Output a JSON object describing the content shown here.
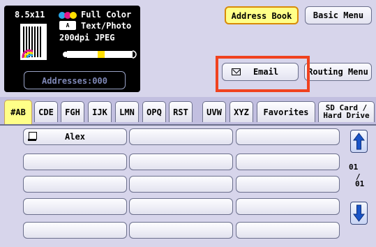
{
  "status": {
    "paper_size": "8.5x11",
    "color_mode": "Full Color",
    "image_mode": "Text/Photo",
    "mode_icon_text": "A ",
    "resolution": "200dpi JPEG",
    "addresses_button": "Addresses:000",
    "color_dots": [
      "#2aa7e8",
      "#e3198a",
      "#ffdf00"
    ]
  },
  "header": {
    "address_book": "Address Book",
    "basic_menu": "Basic Menu",
    "email": "Email",
    "routing_menu": "Routing Menu"
  },
  "tabs": [
    {
      "label": "#AB",
      "active": true
    },
    {
      "label": "CDE"
    },
    {
      "label": "FGH"
    },
    {
      "label": "IJK"
    },
    {
      "label": "LMN"
    },
    {
      "label": "OPQ"
    },
    {
      "label": "RST"
    },
    {
      "label": "UVW"
    },
    {
      "label": "XYZ"
    },
    {
      "label": "Favorites"
    },
    {
      "label_line1": "SD Card /",
      "label_line2": "Hard Drive"
    }
  ],
  "entries": [
    "Alex",
    "",
    "",
    "",
    "",
    "",
    "",
    "",
    "",
    "",
    "",
    "",
    "",
    "",
    ""
  ],
  "pager": {
    "current": "01",
    "separator": "/",
    "total": "01"
  },
  "colors": {
    "accent": "#ffff88",
    "highlight": "#f0421f",
    "background": "#d7d5eb"
  },
  "icons": [
    "pc-icon",
    "mail-icon",
    "up-arrow-icon",
    "down-arrow-icon",
    "page-icon"
  ]
}
